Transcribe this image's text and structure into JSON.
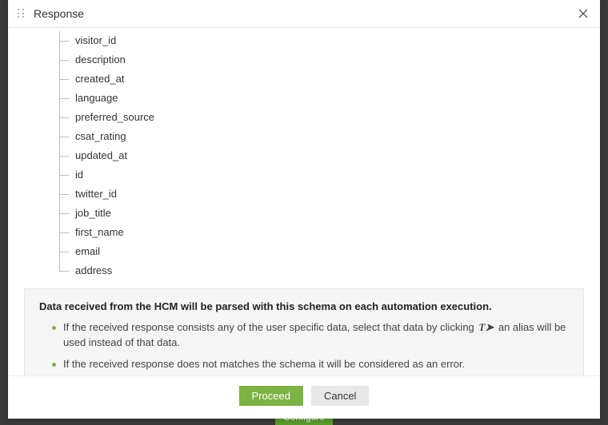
{
  "header": {
    "title": "Response"
  },
  "tree": {
    "items": [
      "visitor_id",
      "description",
      "created_at",
      "language",
      "preferred_source",
      "csat_rating",
      "updated_at",
      "id",
      "twitter_id",
      "job_title",
      "first_name",
      "email",
      "address"
    ]
  },
  "info": {
    "title": "Data received from the HCM will be parsed with this schema on each automation execution.",
    "bullet1_a": "If the received response consists any of the user specific data, select that data by clicking ",
    "bullet1_b": " an alias will be used instead of that data.",
    "bullet2": "If the received response does not matches the schema it will be considered as an error."
  },
  "footer": {
    "proceed": "Proceed",
    "cancel": "Cancel"
  },
  "background": {
    "configure": "Configure"
  },
  "icons": {
    "alias": "T➤"
  }
}
